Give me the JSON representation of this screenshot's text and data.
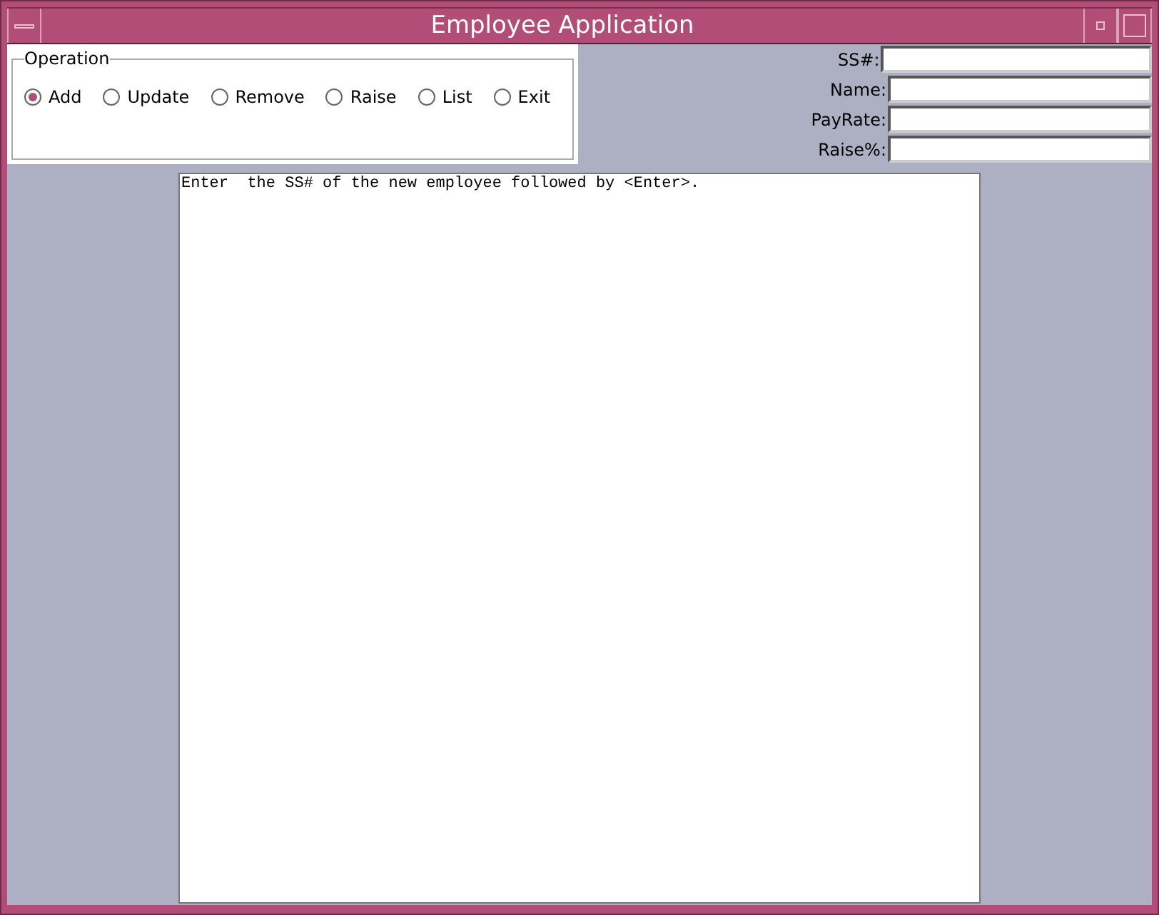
{
  "window": {
    "title": "Employee Application"
  },
  "operation": {
    "legend": "Operation",
    "options": [
      {
        "label": "Add",
        "selected": true
      },
      {
        "label": "Update",
        "selected": false
      },
      {
        "label": "Remove",
        "selected": false
      },
      {
        "label": "Raise",
        "selected": false
      },
      {
        "label": "List",
        "selected": false
      },
      {
        "label": "Exit",
        "selected": false
      }
    ]
  },
  "fields": [
    {
      "label": "SS#:"
    },
    {
      "label": "Name:"
    },
    {
      "label": "PayRate:"
    },
    {
      "label": "Raise%:"
    }
  ],
  "output": {
    "text": "Enter  the SS# of the new employee followed by <Enter>."
  }
}
